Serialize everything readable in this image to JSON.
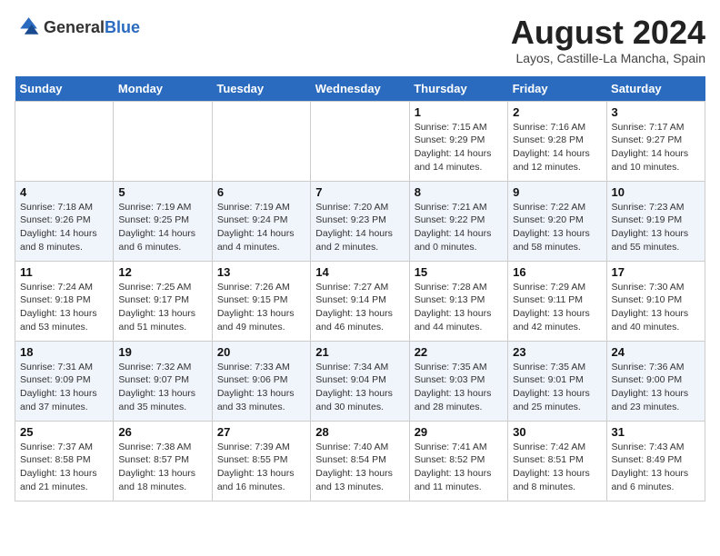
{
  "logo": {
    "general": "General",
    "blue": "Blue"
  },
  "header": {
    "month_year": "August 2024",
    "location": "Layos, Castille-La Mancha, Spain"
  },
  "weekdays": [
    "Sunday",
    "Monday",
    "Tuesday",
    "Wednesday",
    "Thursday",
    "Friday",
    "Saturday"
  ],
  "weeks": [
    [
      {
        "day": "",
        "info": ""
      },
      {
        "day": "",
        "info": ""
      },
      {
        "day": "",
        "info": ""
      },
      {
        "day": "",
        "info": ""
      },
      {
        "day": "1",
        "info": "Sunrise: 7:15 AM\nSunset: 9:29 PM\nDaylight: 14 hours and 14 minutes."
      },
      {
        "day": "2",
        "info": "Sunrise: 7:16 AM\nSunset: 9:28 PM\nDaylight: 14 hours and 12 minutes."
      },
      {
        "day": "3",
        "info": "Sunrise: 7:17 AM\nSunset: 9:27 PM\nDaylight: 14 hours and 10 minutes."
      }
    ],
    [
      {
        "day": "4",
        "info": "Sunrise: 7:18 AM\nSunset: 9:26 PM\nDaylight: 14 hours and 8 minutes."
      },
      {
        "day": "5",
        "info": "Sunrise: 7:19 AM\nSunset: 9:25 PM\nDaylight: 14 hours and 6 minutes."
      },
      {
        "day": "6",
        "info": "Sunrise: 7:19 AM\nSunset: 9:24 PM\nDaylight: 14 hours and 4 minutes."
      },
      {
        "day": "7",
        "info": "Sunrise: 7:20 AM\nSunset: 9:23 PM\nDaylight: 14 hours and 2 minutes."
      },
      {
        "day": "8",
        "info": "Sunrise: 7:21 AM\nSunset: 9:22 PM\nDaylight: 14 hours and 0 minutes."
      },
      {
        "day": "9",
        "info": "Sunrise: 7:22 AM\nSunset: 9:20 PM\nDaylight: 13 hours and 58 minutes."
      },
      {
        "day": "10",
        "info": "Sunrise: 7:23 AM\nSunset: 9:19 PM\nDaylight: 13 hours and 55 minutes."
      }
    ],
    [
      {
        "day": "11",
        "info": "Sunrise: 7:24 AM\nSunset: 9:18 PM\nDaylight: 13 hours and 53 minutes."
      },
      {
        "day": "12",
        "info": "Sunrise: 7:25 AM\nSunset: 9:17 PM\nDaylight: 13 hours and 51 minutes."
      },
      {
        "day": "13",
        "info": "Sunrise: 7:26 AM\nSunset: 9:15 PM\nDaylight: 13 hours and 49 minutes."
      },
      {
        "day": "14",
        "info": "Sunrise: 7:27 AM\nSunset: 9:14 PM\nDaylight: 13 hours and 46 minutes."
      },
      {
        "day": "15",
        "info": "Sunrise: 7:28 AM\nSunset: 9:13 PM\nDaylight: 13 hours and 44 minutes."
      },
      {
        "day": "16",
        "info": "Sunrise: 7:29 AM\nSunset: 9:11 PM\nDaylight: 13 hours and 42 minutes."
      },
      {
        "day": "17",
        "info": "Sunrise: 7:30 AM\nSunset: 9:10 PM\nDaylight: 13 hours and 40 minutes."
      }
    ],
    [
      {
        "day": "18",
        "info": "Sunrise: 7:31 AM\nSunset: 9:09 PM\nDaylight: 13 hours and 37 minutes."
      },
      {
        "day": "19",
        "info": "Sunrise: 7:32 AM\nSunset: 9:07 PM\nDaylight: 13 hours and 35 minutes."
      },
      {
        "day": "20",
        "info": "Sunrise: 7:33 AM\nSunset: 9:06 PM\nDaylight: 13 hours and 33 minutes."
      },
      {
        "day": "21",
        "info": "Sunrise: 7:34 AM\nSunset: 9:04 PM\nDaylight: 13 hours and 30 minutes."
      },
      {
        "day": "22",
        "info": "Sunrise: 7:35 AM\nSunset: 9:03 PM\nDaylight: 13 hours and 28 minutes."
      },
      {
        "day": "23",
        "info": "Sunrise: 7:35 AM\nSunset: 9:01 PM\nDaylight: 13 hours and 25 minutes."
      },
      {
        "day": "24",
        "info": "Sunrise: 7:36 AM\nSunset: 9:00 PM\nDaylight: 13 hours and 23 minutes."
      }
    ],
    [
      {
        "day": "25",
        "info": "Sunrise: 7:37 AM\nSunset: 8:58 PM\nDaylight: 13 hours and 21 minutes."
      },
      {
        "day": "26",
        "info": "Sunrise: 7:38 AM\nSunset: 8:57 PM\nDaylight: 13 hours and 18 minutes."
      },
      {
        "day": "27",
        "info": "Sunrise: 7:39 AM\nSunset: 8:55 PM\nDaylight: 13 hours and 16 minutes."
      },
      {
        "day": "28",
        "info": "Sunrise: 7:40 AM\nSunset: 8:54 PM\nDaylight: 13 hours and 13 minutes."
      },
      {
        "day": "29",
        "info": "Sunrise: 7:41 AM\nSunset: 8:52 PM\nDaylight: 13 hours and 11 minutes."
      },
      {
        "day": "30",
        "info": "Sunrise: 7:42 AM\nSunset: 8:51 PM\nDaylight: 13 hours and 8 minutes."
      },
      {
        "day": "31",
        "info": "Sunrise: 7:43 AM\nSunset: 8:49 PM\nDaylight: 13 hours and 6 minutes."
      }
    ]
  ]
}
